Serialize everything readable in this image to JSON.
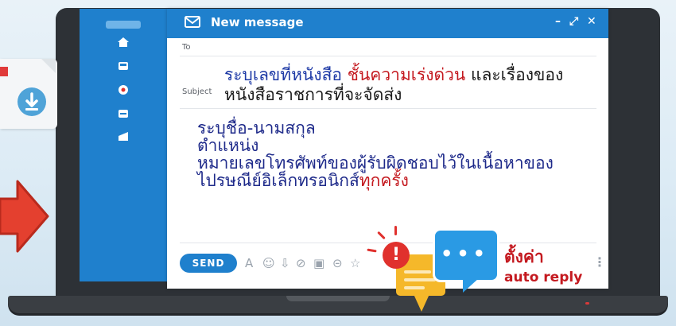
{
  "window": {
    "title": "New message",
    "minimize": "–",
    "expand": "⤢",
    "close": "✕"
  },
  "fields": {
    "to_label": "To",
    "subject_label": "Subject",
    "subject_parts": [
      "ระบุเลขที่หนังสือ",
      "ชั้นความเร่งด่วน",
      "และเรื่องของ",
      "หนังสือราชการที่จะจัดส่ง"
    ]
  },
  "body": {
    "line1": "ระบุชื่อ-นามสกุล",
    "line2": "ตำแหน่ง",
    "line3": "หมายเลขโทรศัพท์ของผู้รับผิดชอบไว้ในเนื้อหาของ",
    "line4_a": "ไปรษณีย์อิเล็กทรอนิกส์",
    "line4_b": "ทุกครั้ง"
  },
  "toolbar": {
    "send_label": "SEND",
    "icons": [
      "A",
      "☺",
      "⇩",
      "⊘",
      "▣",
      "⊝",
      "☆"
    ]
  },
  "callout": {
    "line1": "ตั้งค่า",
    "line2": "auto reply"
  },
  "colors": {
    "accent": "#1f80cd",
    "alert_red": "#c4191f",
    "text_blue": "#1e3aa6"
  }
}
